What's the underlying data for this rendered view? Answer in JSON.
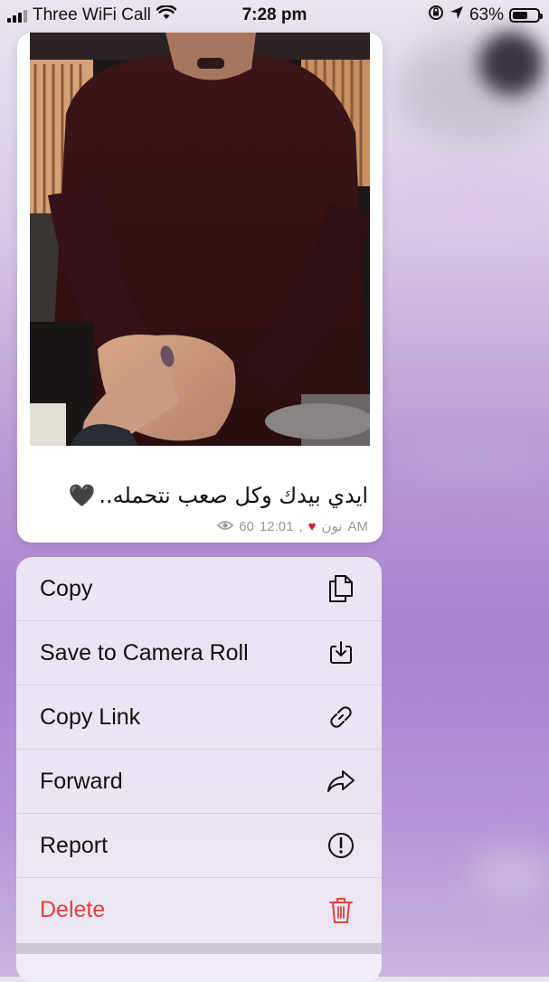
{
  "status_bar": {
    "carrier": "Three WiFi Call",
    "time": "7:28 pm",
    "battery_percent": "63%",
    "battery_level": 0.63,
    "icons": [
      "signal-icon",
      "wifi-icon",
      "orientation-lock-icon",
      "location-icon",
      "battery-icon"
    ]
  },
  "message": {
    "photo_description_icon": "photo",
    "caption": "ايدي بيدك وكل صعب نتحمله..",
    "caption_emoji": "🖤",
    "meta": {
      "views": "60",
      "time": "12:01",
      "signature": "نون",
      "heart": "♥",
      "ampm": "AM"
    }
  },
  "context_menu": {
    "items": [
      {
        "label": "Copy",
        "icon": "copy-icon"
      },
      {
        "label": "Save to Camera Roll",
        "icon": "save-download-icon"
      },
      {
        "label": "Copy Link",
        "icon": "link-icon"
      },
      {
        "label": "Forward",
        "icon": "forward-arrow-icon"
      },
      {
        "label": "Report",
        "icon": "report-exclamation-icon"
      },
      {
        "label": "Delete",
        "icon": "trash-icon"
      }
    ]
  },
  "colors": {
    "destructive": "#e5403a",
    "heart_red": "#d3182b",
    "menu_bg": "#f0ecf4",
    "background_purple": "#a884cf"
  }
}
